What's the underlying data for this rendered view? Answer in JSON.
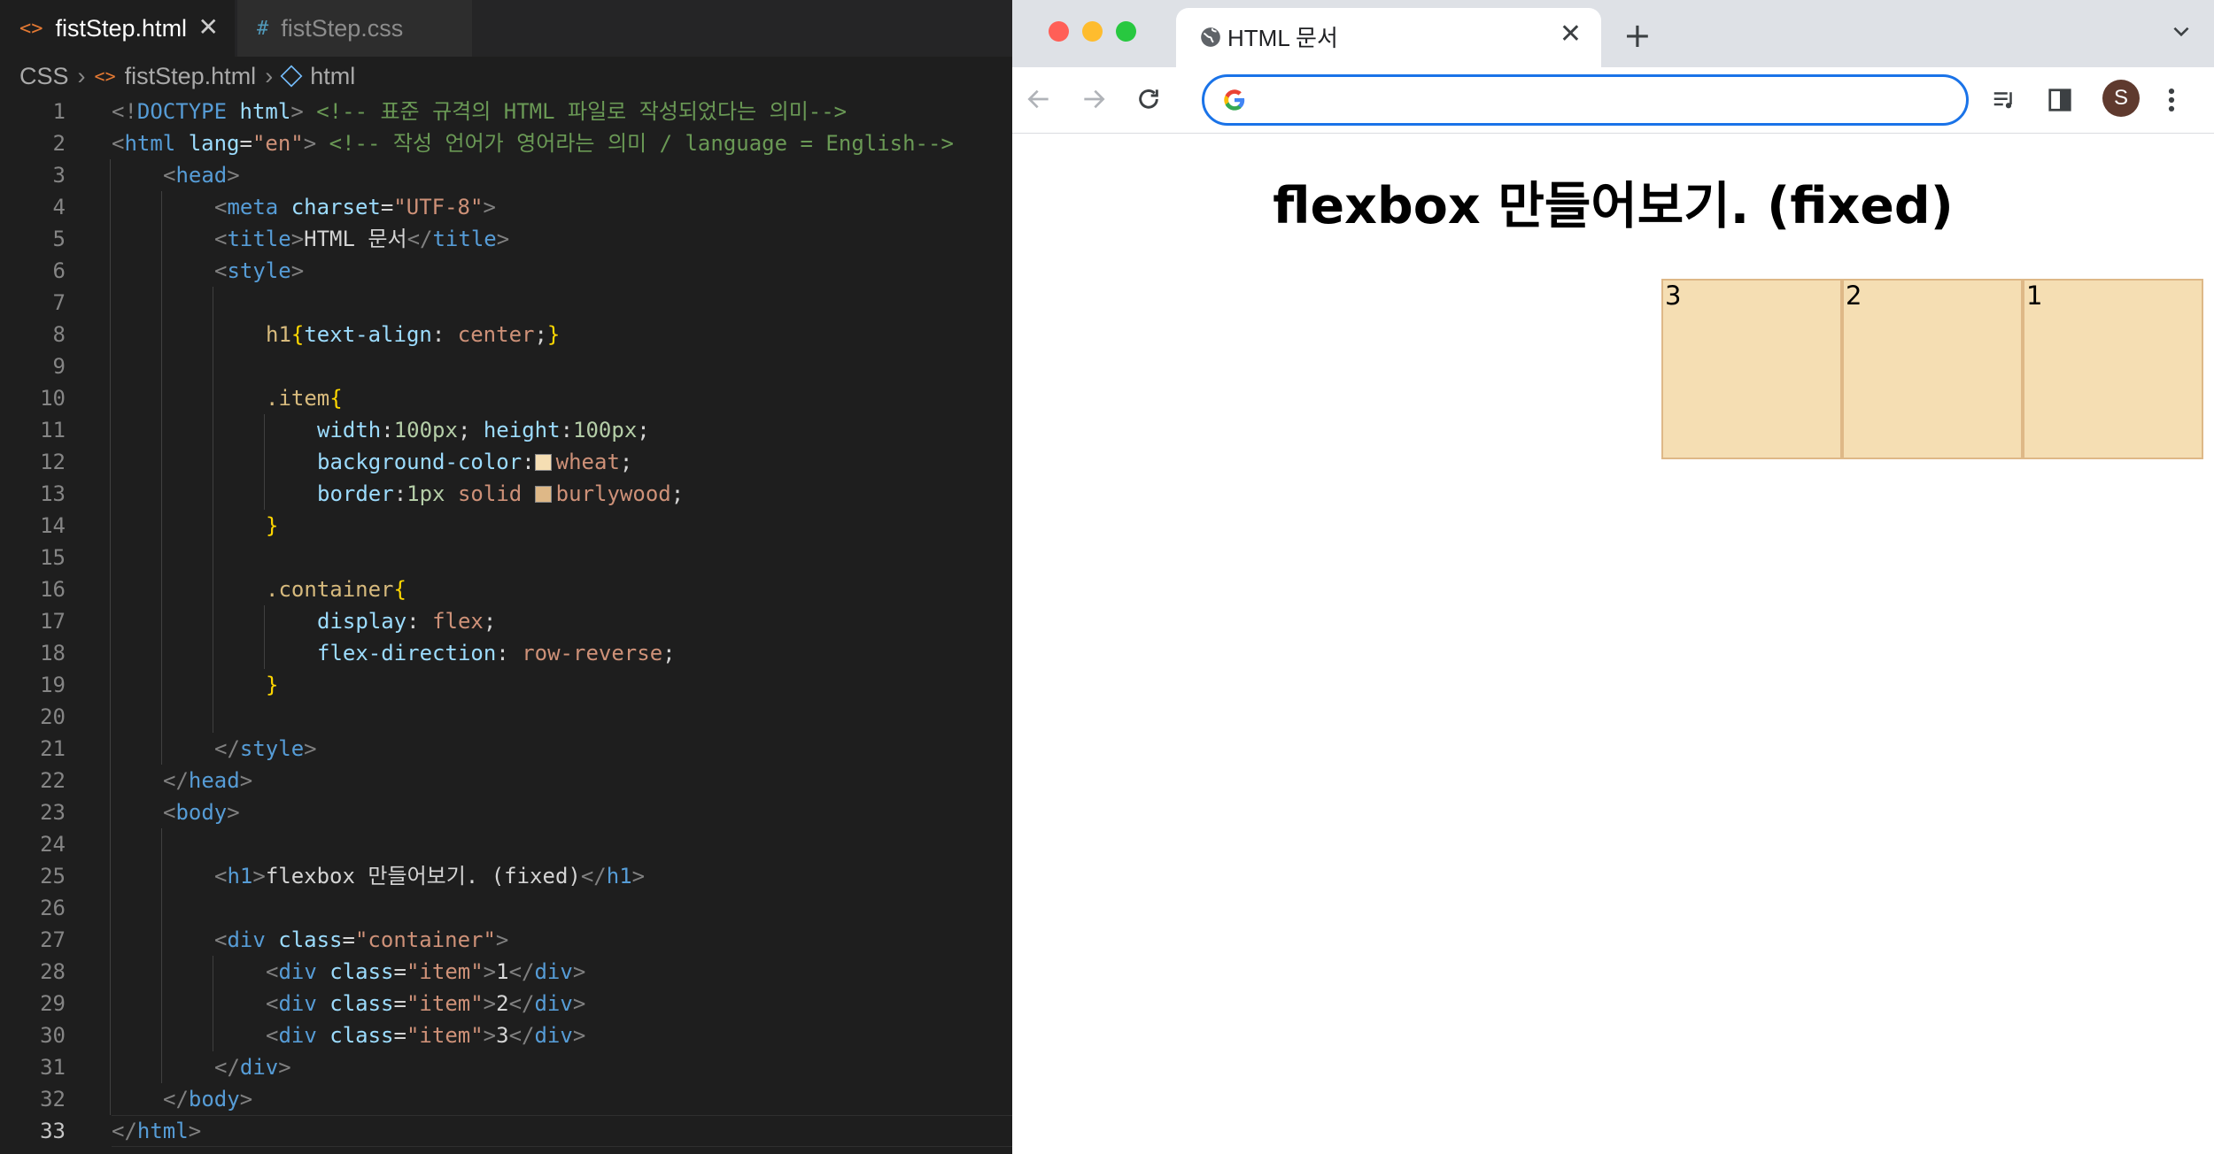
{
  "editor": {
    "tabs": [
      {
        "icon": "<>",
        "label": "fistStep.html",
        "active": true
      },
      {
        "icon": "#",
        "label": "fistStep.css",
        "active": false
      }
    ],
    "breadcrumb": [
      "CSS",
      "fistStep.html",
      "html"
    ],
    "current_line": 33,
    "lines": [
      {
        "n": 1,
        "indent": 0,
        "tokens": [
          {
            "t": "<!",
            "c": "c-br"
          },
          {
            "t": "DOCTYPE",
            "c": "c-tag"
          },
          {
            "t": " html",
            "c": "c-attr"
          },
          {
            "t": ">",
            "c": "c-br"
          },
          {
            "t": " <!-- 표준 규격의 HTML 파일로 작성되었다는 의미-->",
            "c": "c-com"
          }
        ]
      },
      {
        "n": 2,
        "indent": 0,
        "tokens": [
          {
            "t": "<",
            "c": "c-br"
          },
          {
            "t": "html",
            "c": "c-tag"
          },
          {
            "t": " lang",
            "c": "c-attr"
          },
          {
            "t": "=",
            "c": "c-txt"
          },
          {
            "t": "\"en\"",
            "c": "c-str"
          },
          {
            "t": ">",
            "c": "c-br"
          },
          {
            "t": " <!-- 작성 언어가 영어라는 의미 / language = English-->",
            "c": "c-com"
          }
        ]
      },
      {
        "n": 3,
        "indent": 1,
        "tokens": [
          {
            "t": "<",
            "c": "c-br"
          },
          {
            "t": "head",
            "c": "c-tag"
          },
          {
            "t": ">",
            "c": "c-br"
          }
        ]
      },
      {
        "n": 4,
        "indent": 2,
        "tokens": [
          {
            "t": "<",
            "c": "c-br"
          },
          {
            "t": "meta",
            "c": "c-tag"
          },
          {
            "t": " charset",
            "c": "c-attr"
          },
          {
            "t": "=",
            "c": "c-txt"
          },
          {
            "t": "\"UTF-8\"",
            "c": "c-str"
          },
          {
            "t": ">",
            "c": "c-br"
          }
        ]
      },
      {
        "n": 5,
        "indent": 2,
        "tokens": [
          {
            "t": "<",
            "c": "c-br"
          },
          {
            "t": "title",
            "c": "c-tag"
          },
          {
            "t": ">",
            "c": "c-br"
          },
          {
            "t": "HTML 문서",
            "c": "c-txt"
          },
          {
            "t": "</",
            "c": "c-br"
          },
          {
            "t": "title",
            "c": "c-tag"
          },
          {
            "t": ">",
            "c": "c-br"
          }
        ]
      },
      {
        "n": 6,
        "indent": 2,
        "tokens": [
          {
            "t": "<",
            "c": "c-br"
          },
          {
            "t": "style",
            "c": "c-tag"
          },
          {
            "t": ">",
            "c": "c-br"
          }
        ]
      },
      {
        "n": 7,
        "indent": 0,
        "tokens": []
      },
      {
        "n": 8,
        "indent": 3,
        "tokens": [
          {
            "t": "h1",
            "c": "c-sel"
          },
          {
            "t": "{",
            "c": "c-brace"
          },
          {
            "t": "text-align",
            "c": "c-prop"
          },
          {
            "t": ": ",
            "c": "c-pun"
          },
          {
            "t": "center",
            "c": "c-val"
          },
          {
            "t": ";",
            "c": "c-pun"
          },
          {
            "t": "}",
            "c": "c-brace"
          }
        ]
      },
      {
        "n": 9,
        "indent": 0,
        "tokens": []
      },
      {
        "n": 10,
        "indent": 3,
        "tokens": [
          {
            "t": ".item",
            "c": "c-sel"
          },
          {
            "t": "{",
            "c": "c-brace"
          }
        ]
      },
      {
        "n": 11,
        "indent": 4,
        "tokens": [
          {
            "t": "width",
            "c": "c-prop"
          },
          {
            "t": ":",
            "c": "c-pun"
          },
          {
            "t": "100px",
            "c": "c-num"
          },
          {
            "t": "; ",
            "c": "c-pun"
          },
          {
            "t": "height",
            "c": "c-prop"
          },
          {
            "t": ":",
            "c": "c-pun"
          },
          {
            "t": "100px",
            "c": "c-num"
          },
          {
            "t": ";",
            "c": "c-pun"
          }
        ]
      },
      {
        "n": 12,
        "indent": 4,
        "tokens": [
          {
            "t": "background-color",
            "c": "c-prop"
          },
          {
            "t": ":",
            "c": "c-pun"
          },
          {
            "swatch": "#f5deb3"
          },
          {
            "t": "wheat",
            "c": "c-val"
          },
          {
            "t": ";",
            "c": "c-pun"
          }
        ]
      },
      {
        "n": 13,
        "indent": 4,
        "tokens": [
          {
            "t": "border",
            "c": "c-prop"
          },
          {
            "t": ":",
            "c": "c-pun"
          },
          {
            "t": "1px",
            "c": "c-num"
          },
          {
            "t": " solid ",
            "c": "c-val"
          },
          {
            "swatch": "#deb887"
          },
          {
            "t": "burlywood",
            "c": "c-val"
          },
          {
            "t": ";",
            "c": "c-pun"
          }
        ]
      },
      {
        "n": 14,
        "indent": 3,
        "tokens": [
          {
            "t": "}",
            "c": "c-brace"
          }
        ]
      },
      {
        "n": 15,
        "indent": 0,
        "tokens": []
      },
      {
        "n": 16,
        "indent": 3,
        "tokens": [
          {
            "t": ".container",
            "c": "c-sel"
          },
          {
            "t": "{",
            "c": "c-brace"
          }
        ]
      },
      {
        "n": 17,
        "indent": 4,
        "tokens": [
          {
            "t": "display",
            "c": "c-prop"
          },
          {
            "t": ": ",
            "c": "c-pun"
          },
          {
            "t": "flex",
            "c": "c-val"
          },
          {
            "t": ";",
            "c": "c-pun"
          }
        ]
      },
      {
        "n": 18,
        "indent": 4,
        "tokens": [
          {
            "t": "flex-direction",
            "c": "c-prop"
          },
          {
            "t": ": ",
            "c": "c-pun"
          },
          {
            "t": "row-reverse",
            "c": "c-val"
          },
          {
            "t": ";",
            "c": "c-pun"
          }
        ]
      },
      {
        "n": 19,
        "indent": 3,
        "tokens": [
          {
            "t": "}",
            "c": "c-brace"
          }
        ]
      },
      {
        "n": 20,
        "indent": 0,
        "tokens": []
      },
      {
        "n": 21,
        "indent": 2,
        "tokens": [
          {
            "t": "</",
            "c": "c-br"
          },
          {
            "t": "style",
            "c": "c-tag"
          },
          {
            "t": ">",
            "c": "c-br"
          }
        ]
      },
      {
        "n": 22,
        "indent": 1,
        "tokens": [
          {
            "t": "</",
            "c": "c-br"
          },
          {
            "t": "head",
            "c": "c-tag"
          },
          {
            "t": ">",
            "c": "c-br"
          }
        ]
      },
      {
        "n": 23,
        "indent": 1,
        "tokens": [
          {
            "t": "<",
            "c": "c-br"
          },
          {
            "t": "body",
            "c": "c-tag"
          },
          {
            "t": ">",
            "c": "c-br"
          }
        ]
      },
      {
        "n": 24,
        "indent": 0,
        "tokens": []
      },
      {
        "n": 25,
        "indent": 2,
        "tokens": [
          {
            "t": "<",
            "c": "c-br"
          },
          {
            "t": "h1",
            "c": "c-tag"
          },
          {
            "t": ">",
            "c": "c-br"
          },
          {
            "t": "flexbox 만들어보기. (fixed)",
            "c": "c-txt"
          },
          {
            "t": "</",
            "c": "c-br"
          },
          {
            "t": "h1",
            "c": "c-tag"
          },
          {
            "t": ">",
            "c": "c-br"
          }
        ]
      },
      {
        "n": 26,
        "indent": 0,
        "tokens": []
      },
      {
        "n": 27,
        "indent": 2,
        "tokens": [
          {
            "t": "<",
            "c": "c-br"
          },
          {
            "t": "div",
            "c": "c-tag"
          },
          {
            "t": " class",
            "c": "c-attr"
          },
          {
            "t": "=",
            "c": "c-txt"
          },
          {
            "t": "\"container\"",
            "c": "c-str"
          },
          {
            "t": ">",
            "c": "c-br"
          }
        ]
      },
      {
        "n": 28,
        "indent": 3,
        "tokens": [
          {
            "t": "<",
            "c": "c-br"
          },
          {
            "t": "div",
            "c": "c-tag"
          },
          {
            "t": " class",
            "c": "c-attr"
          },
          {
            "t": "=",
            "c": "c-txt"
          },
          {
            "t": "\"item\"",
            "c": "c-str"
          },
          {
            "t": ">",
            "c": "c-br"
          },
          {
            "t": "1",
            "c": "c-txt"
          },
          {
            "t": "</",
            "c": "c-br"
          },
          {
            "t": "div",
            "c": "c-tag"
          },
          {
            "t": ">",
            "c": "c-br"
          }
        ]
      },
      {
        "n": 29,
        "indent": 3,
        "tokens": [
          {
            "t": "<",
            "c": "c-br"
          },
          {
            "t": "div",
            "c": "c-tag"
          },
          {
            "t": " class",
            "c": "c-attr"
          },
          {
            "t": "=",
            "c": "c-txt"
          },
          {
            "t": "\"item\"",
            "c": "c-str"
          },
          {
            "t": ">",
            "c": "c-br"
          },
          {
            "t": "2",
            "c": "c-txt"
          },
          {
            "t": "</",
            "c": "c-br"
          },
          {
            "t": "div",
            "c": "c-tag"
          },
          {
            "t": ">",
            "c": "c-br"
          }
        ]
      },
      {
        "n": 30,
        "indent": 3,
        "tokens": [
          {
            "t": "<",
            "c": "c-br"
          },
          {
            "t": "div",
            "c": "c-tag"
          },
          {
            "t": " class",
            "c": "c-attr"
          },
          {
            "t": "=",
            "c": "c-txt"
          },
          {
            "t": "\"item\"",
            "c": "c-str"
          },
          {
            "t": ">",
            "c": "c-br"
          },
          {
            "t": "3",
            "c": "c-txt"
          },
          {
            "t": "</",
            "c": "c-br"
          },
          {
            "t": "div",
            "c": "c-tag"
          },
          {
            "t": ">",
            "c": "c-br"
          }
        ]
      },
      {
        "n": 31,
        "indent": 2,
        "tokens": [
          {
            "t": "</",
            "c": "c-br"
          },
          {
            "t": "div",
            "c": "c-tag"
          },
          {
            "t": ">",
            "c": "c-br"
          }
        ]
      },
      {
        "n": 32,
        "indent": 1,
        "tokens": [
          {
            "t": "</",
            "c": "c-br"
          },
          {
            "t": "body",
            "c": "c-tag"
          },
          {
            "t": ">",
            "c": "c-br"
          }
        ]
      },
      {
        "n": 33,
        "indent": 0,
        "tokens": [
          {
            "t": "</",
            "c": "c-br"
          },
          {
            "t": "html",
            "c": "c-tag"
          },
          {
            "t": ">",
            "c": "c-br"
          }
        ]
      }
    ]
  },
  "browser": {
    "tab_title": "HTML 문서",
    "new_tab": "+",
    "address_value": "",
    "profile_initial": "S",
    "page": {
      "heading": "flexbox 만들어보기. (fixed)",
      "items": [
        "1",
        "2",
        "3"
      ]
    },
    "colors": {
      "item_bg": "#f5deb3",
      "item_border": "#deb887",
      "accent": "#1a73e8"
    }
  }
}
